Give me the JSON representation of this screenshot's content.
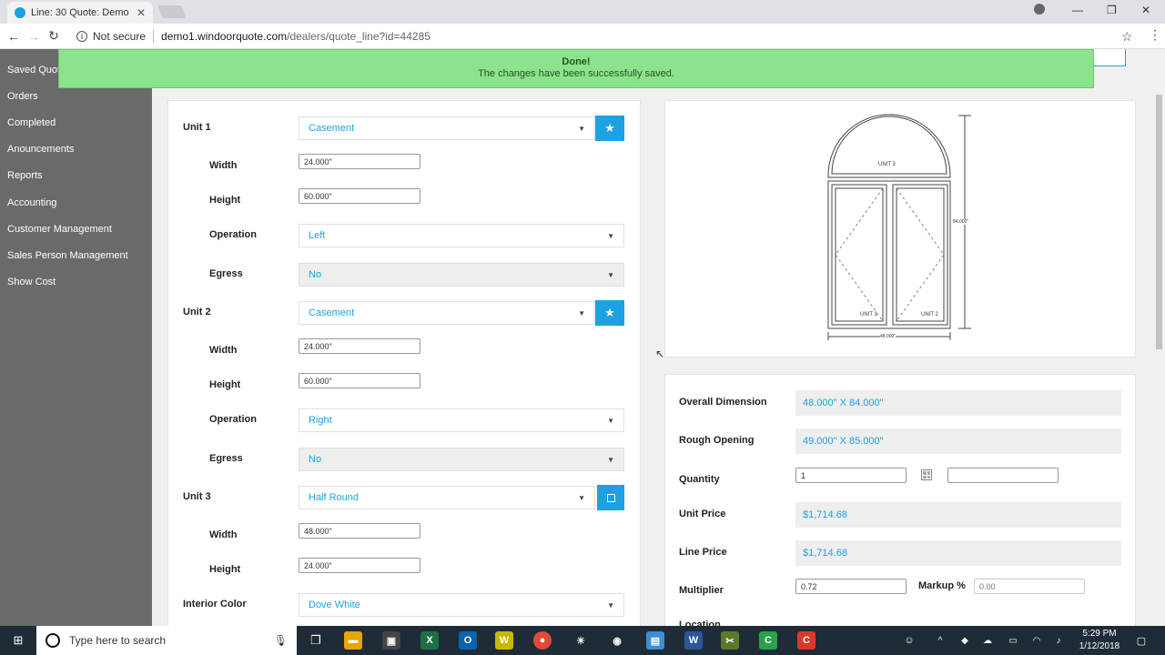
{
  "browser": {
    "tab_title": "Line: 30   Quote: Demo",
    "tab_close": "✕",
    "not_secure": "Not secure",
    "url_host": "demo1.windoorquote.com",
    "url_path": "/dealers/quote_line?id=44285"
  },
  "sidebar": {
    "items": [
      "Saved Quot",
      "Orders",
      "Completed",
      "Anouncements",
      "Reports",
      "Accounting",
      "Customer Management",
      "Sales Person Management",
      "Show Cost"
    ]
  },
  "toast": {
    "title": "Done!",
    "message": "The changes have been successfully saved."
  },
  "form": {
    "unit1": {
      "label": "Unit 1",
      "type": "Casement",
      "width_label": "Width",
      "width": "24.000\"",
      "height_label": "Height",
      "height": "60.000\"",
      "operation_label": "Operation",
      "operation": "Left",
      "egress_label": "Egress",
      "egress": "No"
    },
    "unit2": {
      "label": "Unit 2",
      "type": "Casement",
      "width_label": "Width",
      "width": "24.000\"",
      "height_label": "Height",
      "height": "60.000\"",
      "operation_label": "Operation",
      "operation": "Right",
      "egress_label": "Egress",
      "egress": "No"
    },
    "unit3": {
      "label": "Unit 3",
      "type": "Half Round",
      "width_label": "Width",
      "width": "48.000\"",
      "height_label": "Height",
      "height": "24.000\""
    },
    "interior_color_label": "Interior Color",
    "interior_color": "Dove White"
  },
  "drawing": {
    "unit1": "UNIT 1",
    "unit2": "UNIT 2",
    "unit3": "UNIT 3",
    "width_dim": "48.000\"",
    "height_dim": "84.000\""
  },
  "pricing": {
    "overall_label": "Overall Dimension",
    "overall": "48.000\" X 84.000\"",
    "rough_label": "Rough Opening",
    "rough": "49.000\" X 85.000\"",
    "quantity_label": "Quantity",
    "quantity": "1",
    "unit_price_label": "Unit Price",
    "unit_price": "$1,714.68",
    "line_price_label": "Line Price",
    "line_price": "$1,714.68",
    "multiplier_label": "Multiplier",
    "multiplier": "0.72",
    "markup_label": "Markup %",
    "markup_placeholder": "0.00",
    "location_label": "Location"
  },
  "taskbar": {
    "search_placeholder": "Type here to search",
    "time": "5:29 PM",
    "date": "1/12/2018"
  }
}
